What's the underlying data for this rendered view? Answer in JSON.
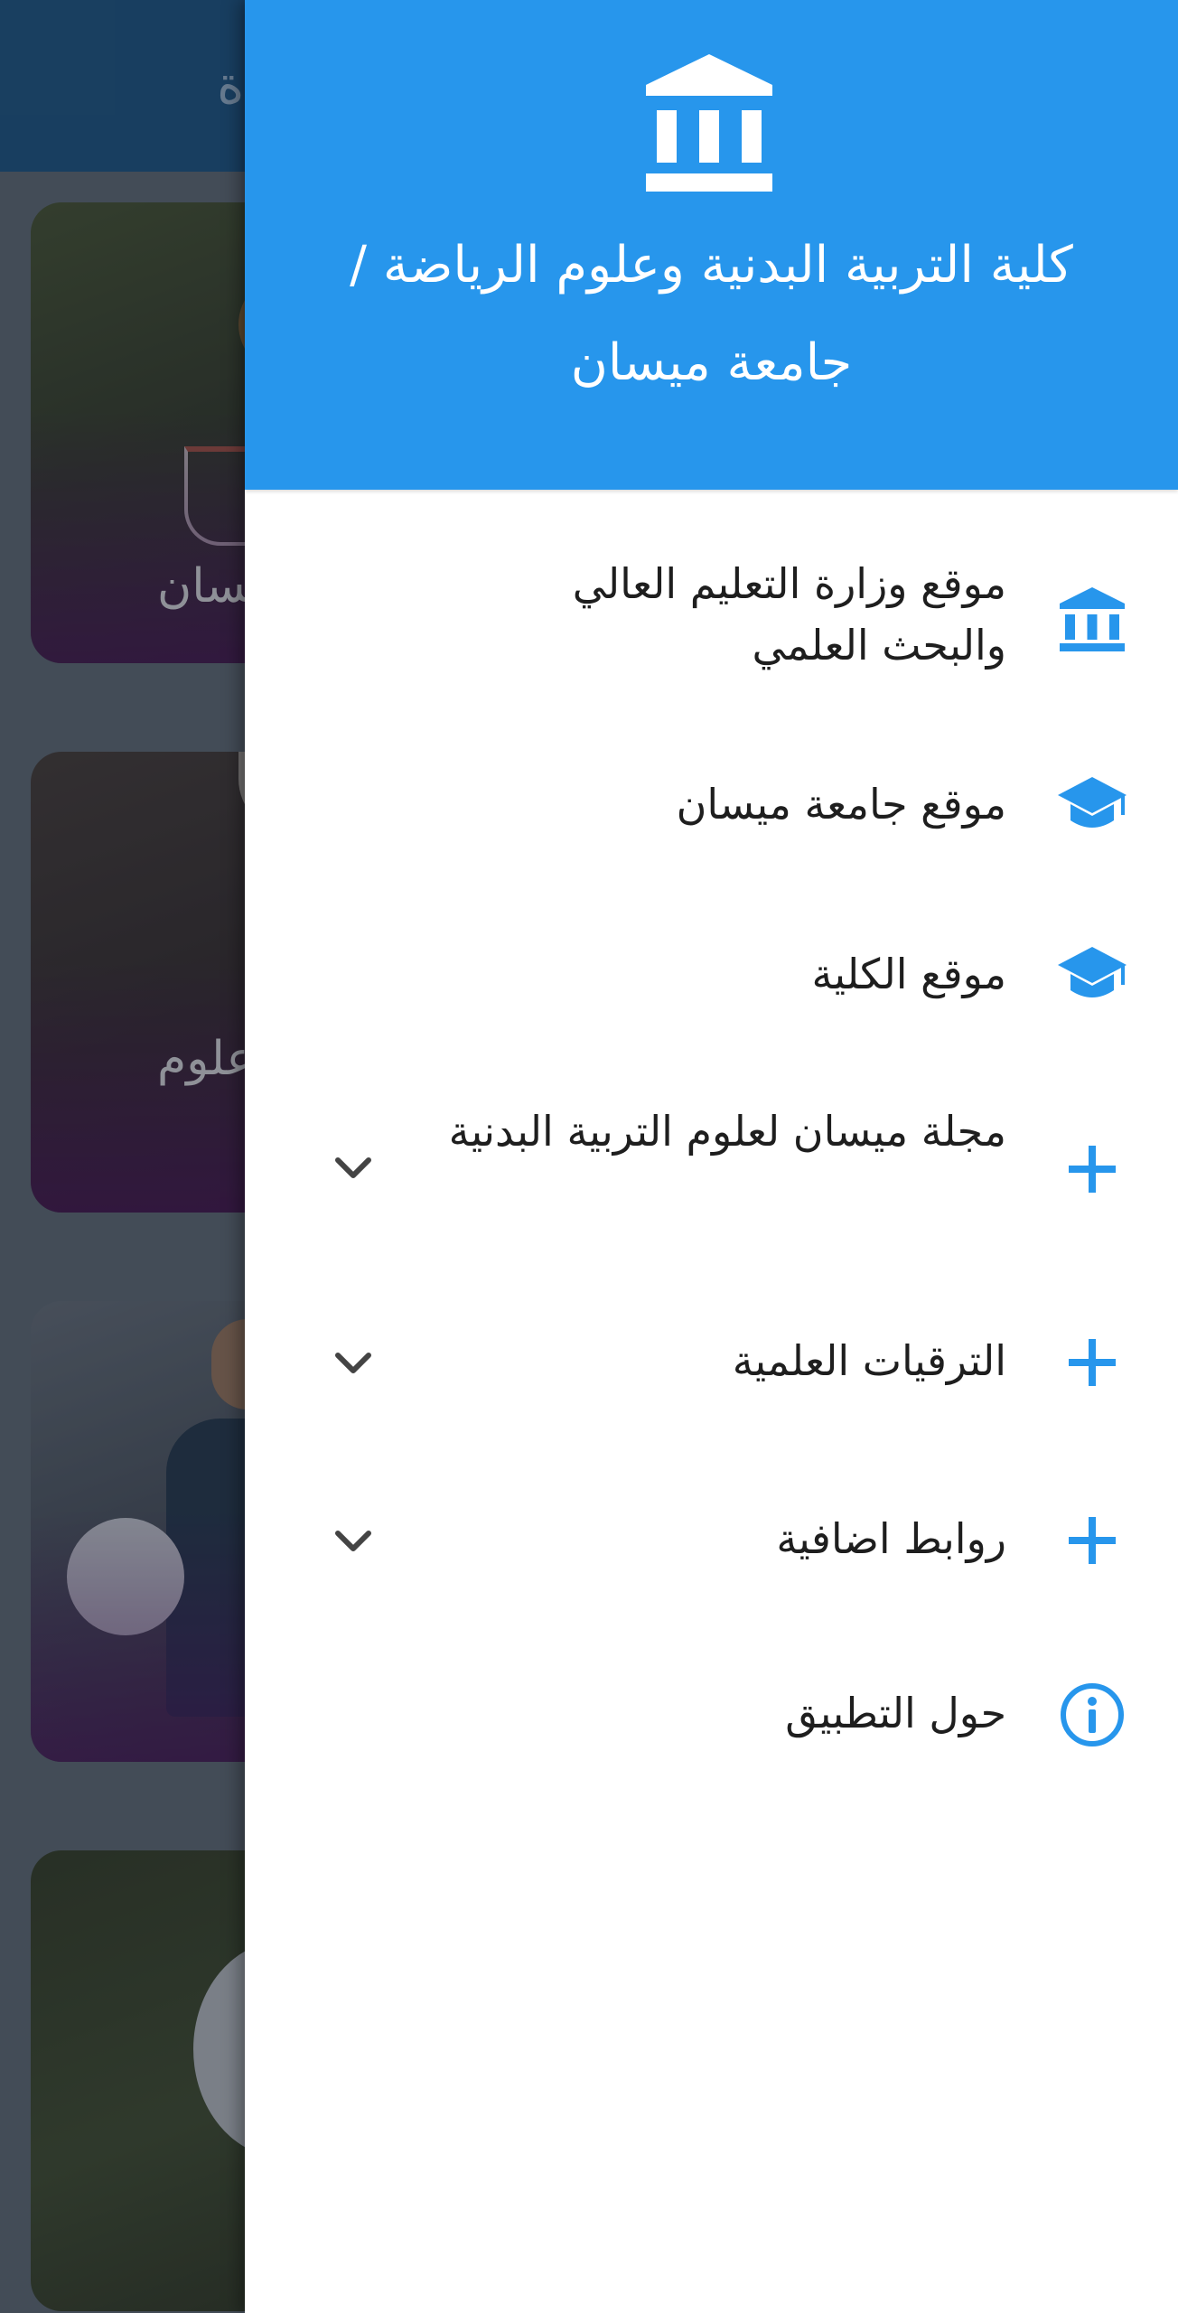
{
  "colors": {
    "accent": "#2796ec",
    "drawer_bg": "#ffffff",
    "text": "#1e1e1e",
    "chevron": "#444444"
  },
  "background": {
    "appbar_title": "ة",
    "cards": [
      {
        "caption": "يسان"
      },
      {
        "caption": "علوم"
      },
      {
        "caption": ""
      },
      {
        "caption": ""
      }
    ]
  },
  "drawer": {
    "header": {
      "icon": "university-icon",
      "title": "كلية التربية البدنية وعلوم الرياضة / جامعة ميسان"
    },
    "items": [
      {
        "label": "موقع وزارة التعليم العالي والبحث العلمي",
        "icon": "university-icon",
        "expandable": false
      },
      {
        "label": "موقع جامعة ميسان",
        "icon": "graduation-cap-icon",
        "expandable": false
      },
      {
        "label": "موقع الكلية",
        "icon": "graduation-cap-icon",
        "expandable": false
      },
      {
        "label": "مجلة ميسان لعلوم التربية البدنية",
        "icon": "plus-icon",
        "expandable": true
      },
      {
        "label": "الترقيات العلمية",
        "icon": "plus-icon",
        "expandable": true
      },
      {
        "label": "روابط اضافية",
        "icon": "plus-icon",
        "expandable": true
      },
      {
        "label": "حول التطبيق",
        "icon": "info-icon",
        "expandable": false
      }
    ]
  }
}
